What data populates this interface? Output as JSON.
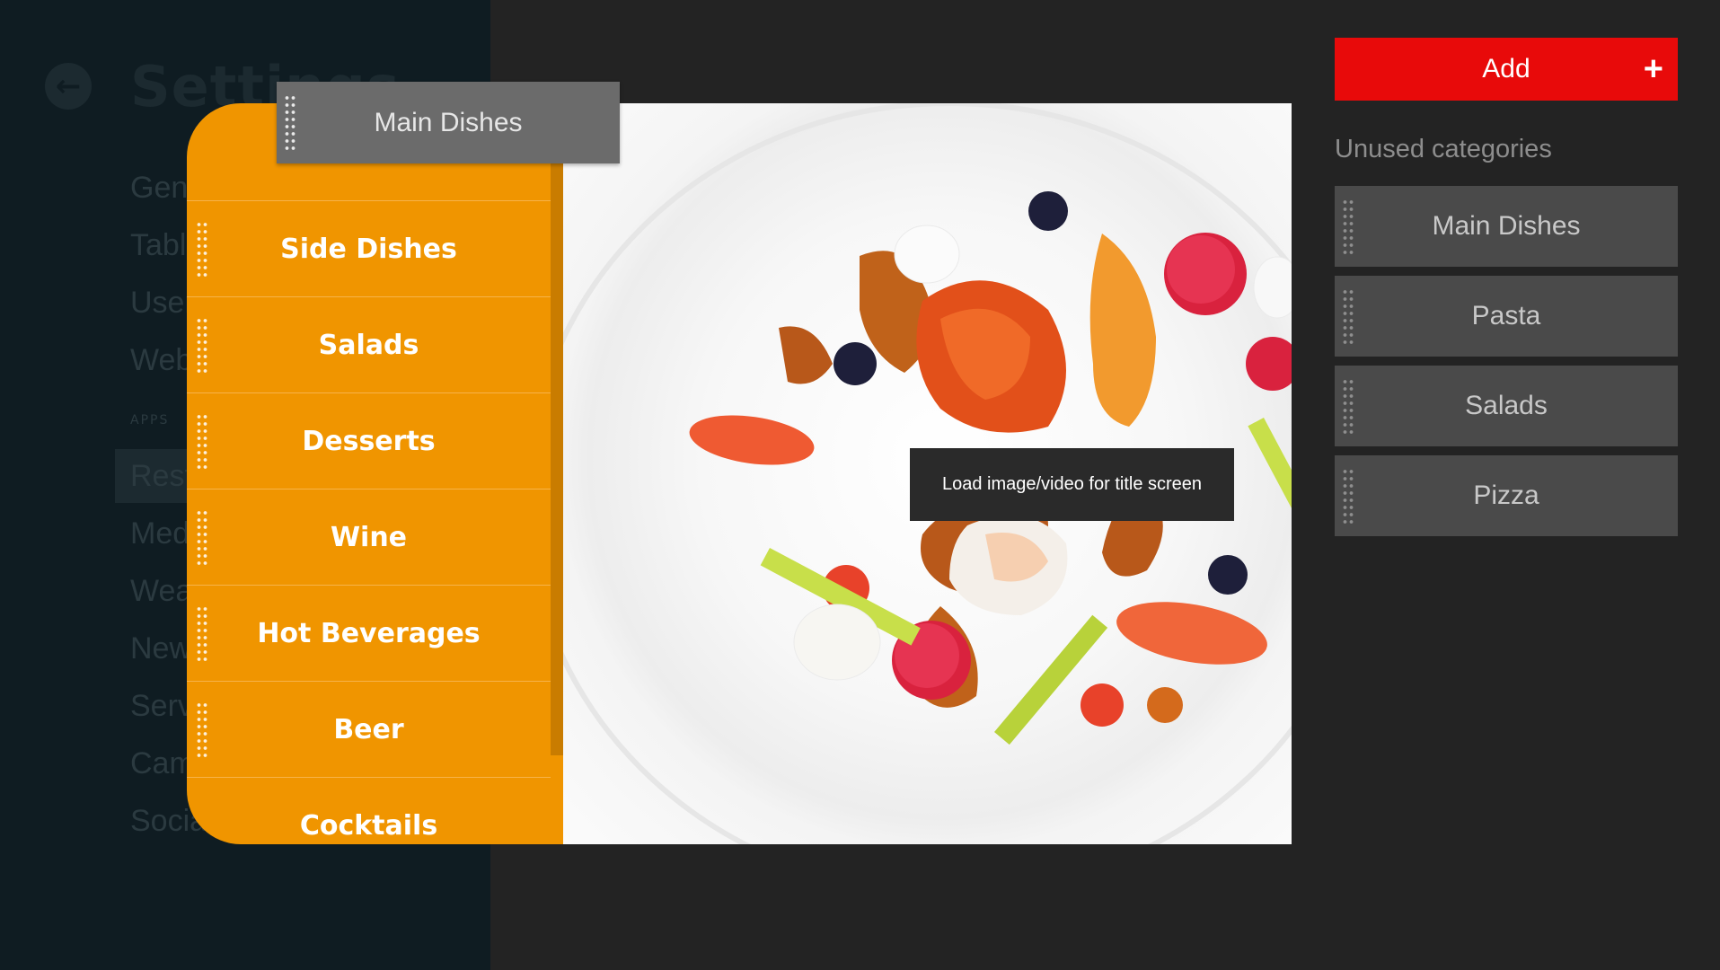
{
  "settings": {
    "title": "Settings",
    "menu": [
      "General",
      "Tables",
      "Users",
      "Website",
      "Restaurant",
      "Media",
      "Weather",
      "News",
      "Service",
      "Camera",
      "Social"
    ],
    "section_label": "APPS"
  },
  "dragged_item": {
    "label": "Main Dishes"
  },
  "categories": [
    {
      "label": "Side Dishes"
    },
    {
      "label": "Salads"
    },
    {
      "label": "Desserts"
    },
    {
      "label": "Wine"
    },
    {
      "label": "Hot Beverages"
    },
    {
      "label": "Beer"
    },
    {
      "label": "Cocktails"
    }
  ],
  "preview": {
    "load_label": "Load image/video for title screen"
  },
  "sidebar": {
    "add_label": "Add",
    "add_icon": "+",
    "unused_label": "Unused categories",
    "unused": [
      {
        "label": "Main Dishes"
      },
      {
        "label": "Pasta"
      },
      {
        "label": "Salads"
      },
      {
        "label": "Pizza"
      }
    ]
  },
  "colors": {
    "accent_orange": "#f09500",
    "add_red": "#e80a0a",
    "settings_bg": "#0f1c22",
    "panel_bg": "#232323"
  }
}
